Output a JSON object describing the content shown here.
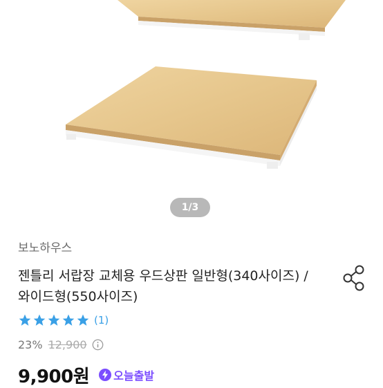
{
  "gallery": {
    "counter": "1/3"
  },
  "product": {
    "brand": "보노하우스",
    "title": "젠틀리 서랍장 교체용 우드상판 일반형(340사이즈) / 와이드형(550사이즈)",
    "rating": {
      "stars": 5,
      "count": "(1)"
    },
    "discount": "23%",
    "original_price": "12,900",
    "price": "9,900원",
    "delivery_badge": "오늘출발"
  },
  "colors": {
    "star": "#3aa0e6",
    "badge": "#7b4dff",
    "wood": "#e8c98f"
  },
  "icons": [
    "share-icon",
    "star-icon",
    "info-icon",
    "lightning-icon"
  ]
}
